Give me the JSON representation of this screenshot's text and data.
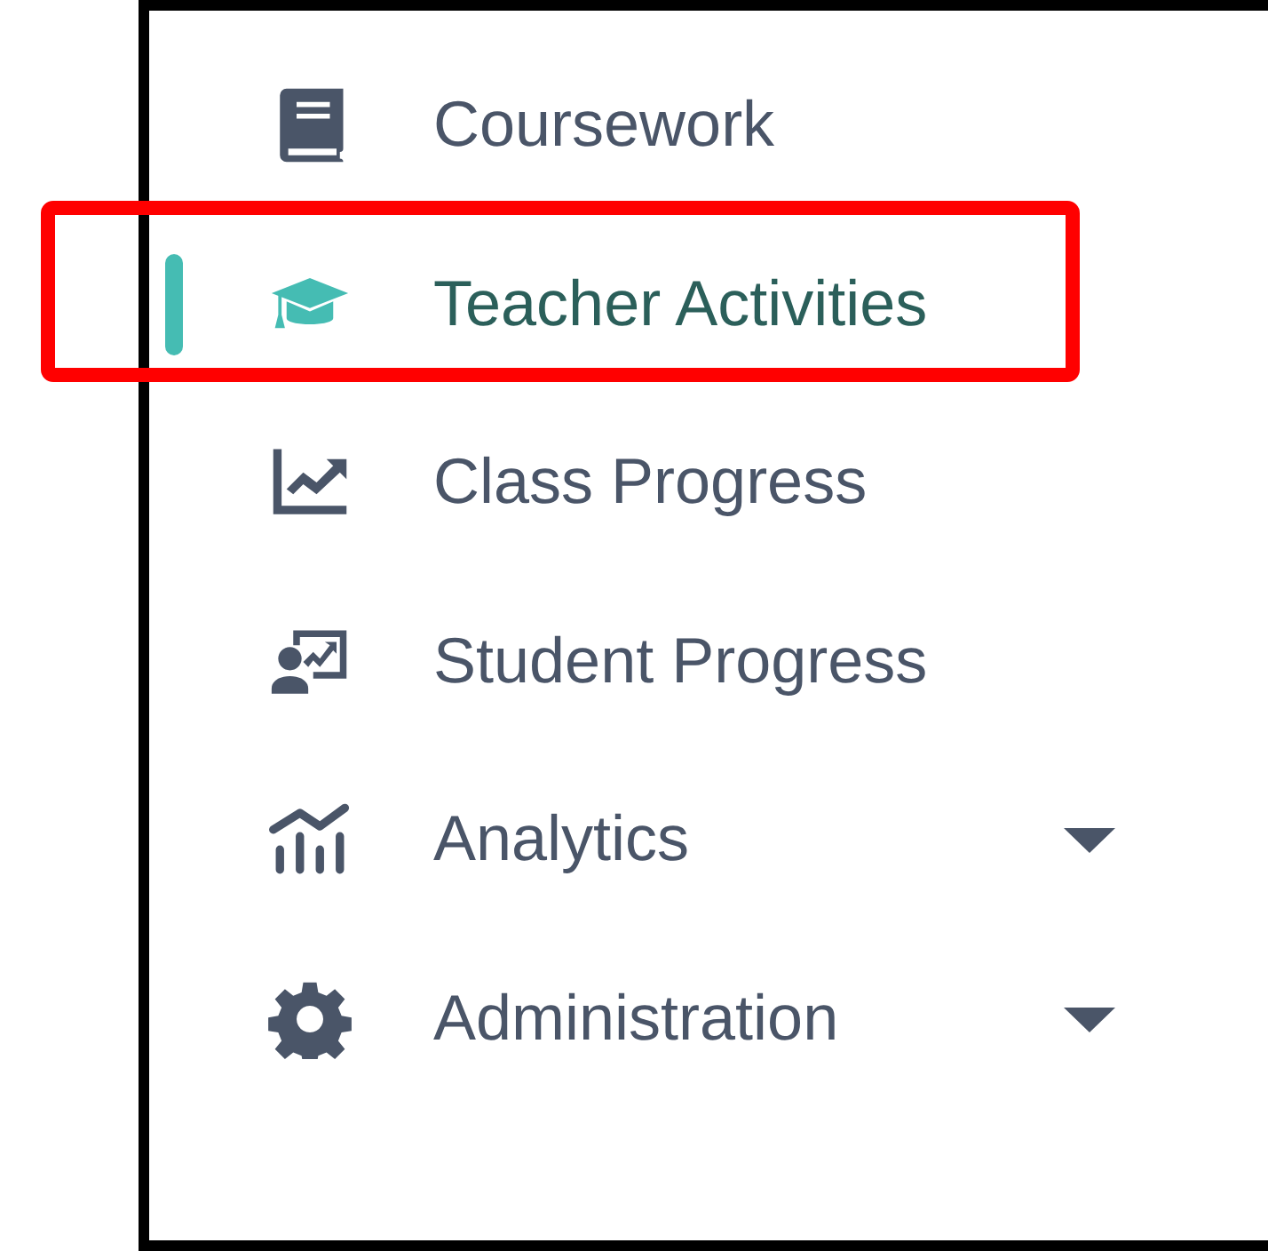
{
  "sidebar": {
    "items": [
      {
        "label": "Coursework",
        "selected": false,
        "expandable": false,
        "annotated": false
      },
      {
        "label": "Teacher Activities",
        "selected": true,
        "expandable": false,
        "annotated": true
      },
      {
        "label": "Class Progress",
        "selected": false,
        "expandable": false,
        "annotated": false
      },
      {
        "label": "Student Progress",
        "selected": false,
        "expandable": false,
        "annotated": false
      },
      {
        "label": "Analytics",
        "selected": false,
        "expandable": true,
        "annotated": false
      },
      {
        "label": "Administration",
        "selected": false,
        "expandable": true,
        "annotated": false
      }
    ]
  }
}
